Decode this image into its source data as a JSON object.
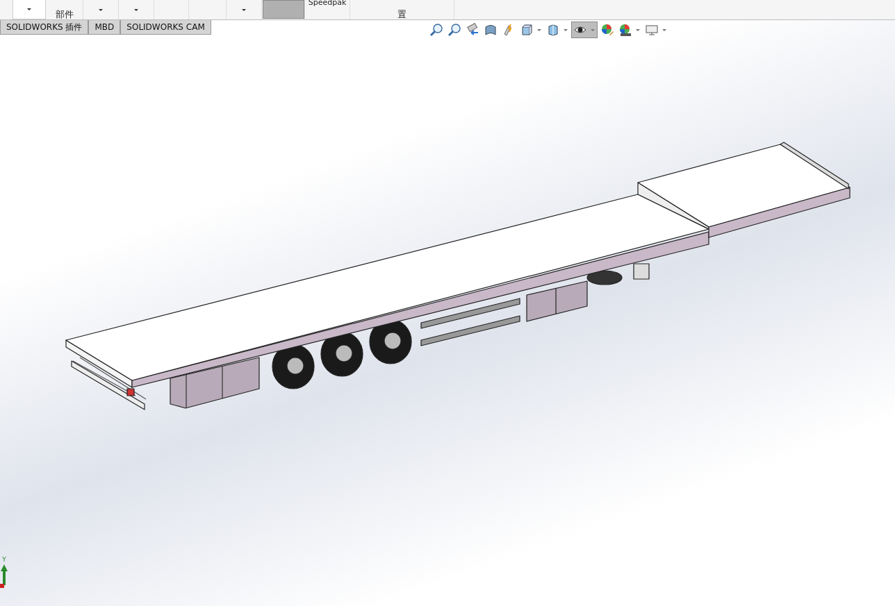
{
  "ribbon": {
    "items": [
      {
        "kind": "split-box"
      },
      {
        "kind": "label",
        "text": "部件"
      },
      {
        "kind": "dropdown"
      },
      {
        "kind": "dropdown"
      },
      {
        "kind": "blank"
      },
      {
        "kind": "blank"
      },
      {
        "kind": "dropdown"
      },
      {
        "kind": "swatch"
      },
      {
        "kind": "label",
        "text": "Speedpak"
      },
      {
        "kind": "label",
        "text": "置"
      }
    ]
  },
  "tabs": [
    {
      "label": "SOLIDWORKS 插件",
      "selected": false
    },
    {
      "label": "MBD",
      "selected": false
    },
    {
      "label": "SOLIDWORKS CAM",
      "selected": false
    }
  ],
  "view_toolbar": {
    "buttons": [
      {
        "kind": "zoom-fit",
        "pressed": false,
        "dropdown": false
      },
      {
        "kind": "zoom-area",
        "pressed": false,
        "dropdown": false
      },
      {
        "kind": "previous-view",
        "pressed": false,
        "dropdown": false
      },
      {
        "kind": "section",
        "pressed": false,
        "dropdown": false
      },
      {
        "kind": "annotation",
        "pressed": false,
        "dropdown": false
      },
      {
        "kind": "orientation",
        "pressed": false,
        "dropdown": true
      },
      {
        "kind": "display-style",
        "pressed": false,
        "dropdown": true
      },
      {
        "kind": "hide-show",
        "pressed": true,
        "dropdown": true
      },
      {
        "kind": "appearance",
        "pressed": false,
        "dropdown": false
      },
      {
        "kind": "scene",
        "pressed": false,
        "dropdown": true
      },
      {
        "kind": "display",
        "pressed": false,
        "dropdown": true
      }
    ]
  },
  "triad": {
    "label": "Y"
  }
}
